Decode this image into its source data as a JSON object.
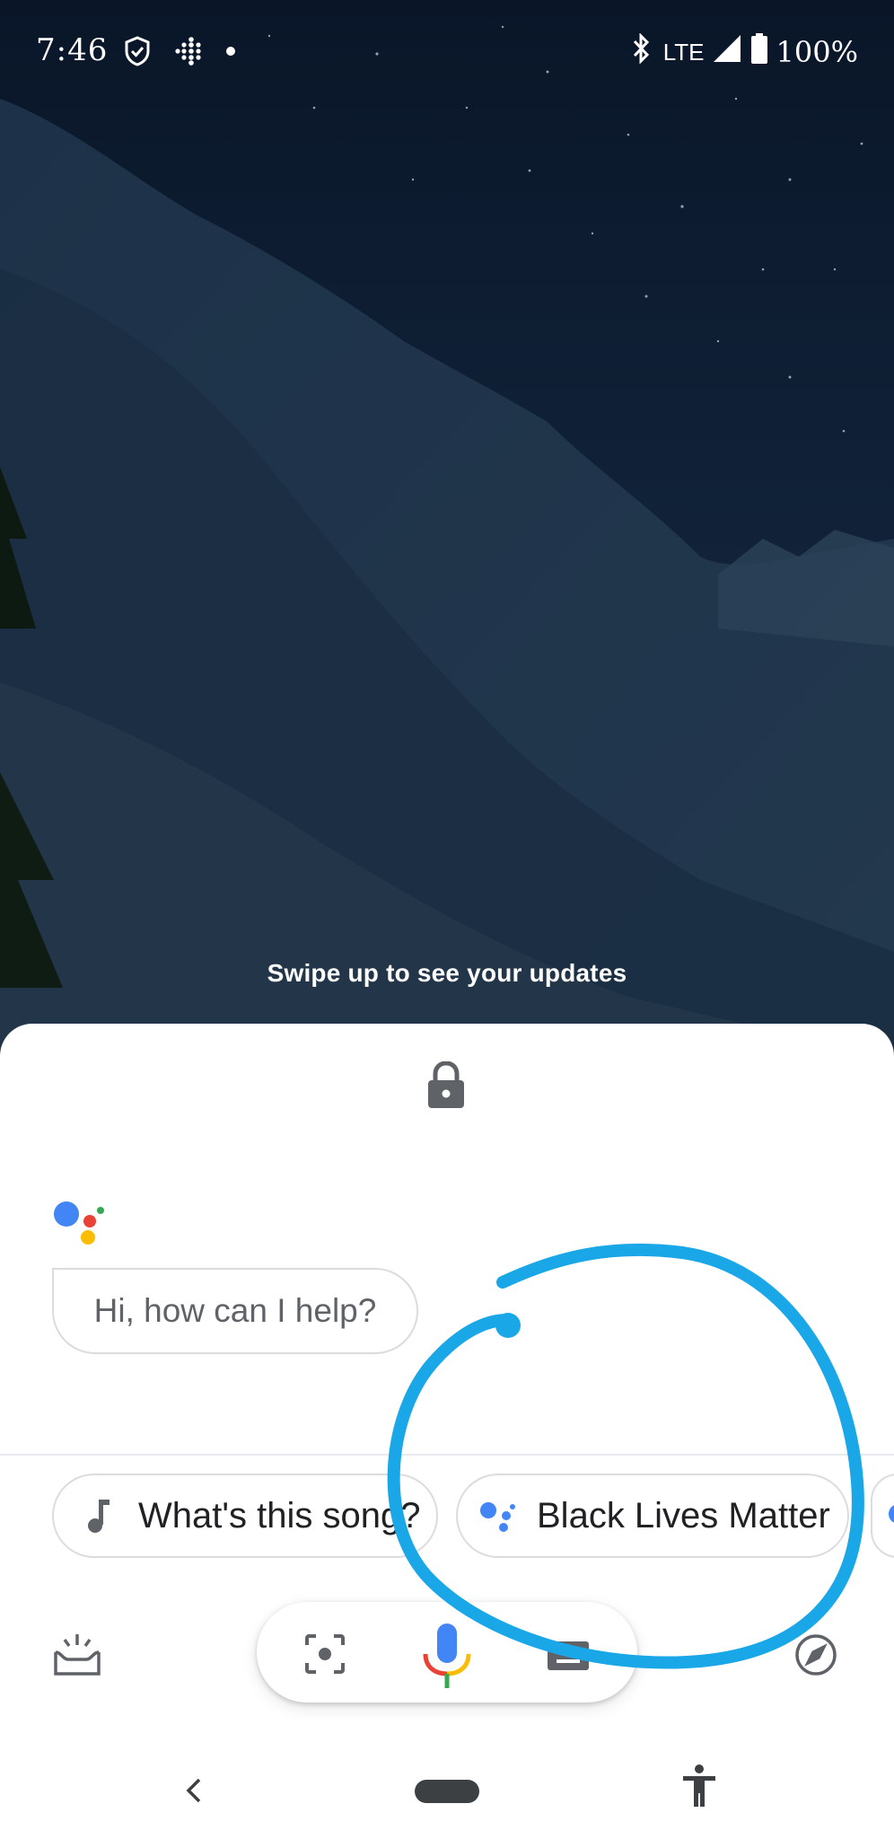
{
  "status_bar": {
    "time": "7:46",
    "network": "LTE",
    "battery": "100%",
    "icons": [
      "shield-check-icon",
      "fitbit-icon",
      "notification-dot-icon",
      "bluetooth-icon",
      "signal-icon",
      "battery-icon"
    ]
  },
  "lockscreen": {
    "swipe_hint": "Swipe up to see your updates"
  },
  "assistant": {
    "greeting": "Hi, how can I help?",
    "chips": [
      {
        "label": "What's this song?",
        "icon": "music-note-icon"
      },
      {
        "label": "Black Lives Matter",
        "icon": "assistant-dots-icon"
      }
    ],
    "bottom_icons": [
      "snapshot-icon",
      "lens-icon",
      "mic-icon",
      "keyboard-icon",
      "explore-icon"
    ]
  },
  "nav": {
    "icons": [
      "back-icon",
      "home-pill",
      "accessibility-icon"
    ]
  },
  "colors": {
    "google_blue": "#4285f4",
    "google_red": "#ea4335",
    "google_yellow": "#fbbc04",
    "google_green": "#34a853",
    "annotation_blue": "#1aa7e8",
    "icon_gray": "#5f6368"
  }
}
